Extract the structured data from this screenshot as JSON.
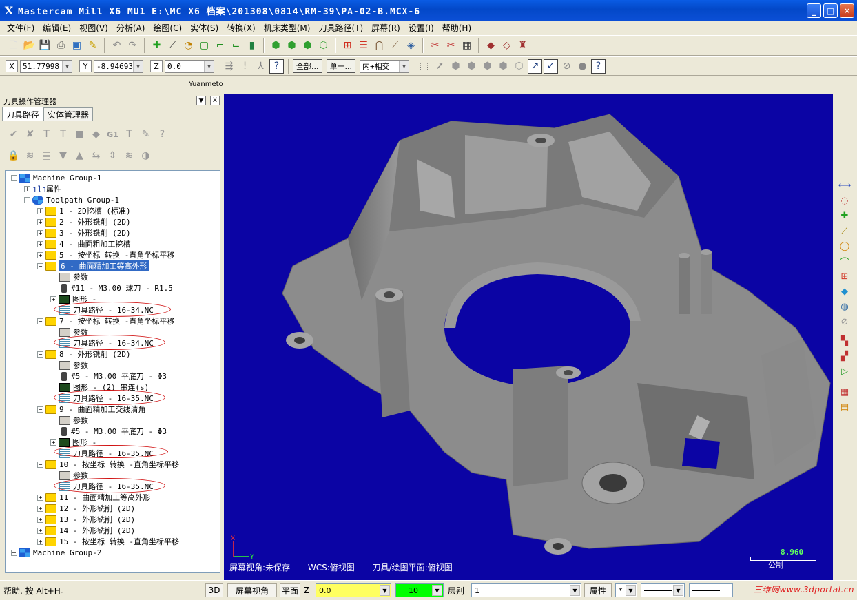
{
  "window": {
    "app_icon": "X",
    "title": "Mastercam Mill X6 MU1  E:\\MC X6 档案\\201308\\0814\\RM-39\\PA-02-B.MCX-6",
    "min_icon": "minimize-icon",
    "max_icon": "maximize-icon",
    "close_icon": "close-icon"
  },
  "menu": [
    "文件(F)",
    "编辑(E)",
    "视图(V)",
    "分析(A)",
    "绘图(C)",
    "实体(S)",
    "转换(X)",
    "机床类型(M)",
    "刀具路径(T)",
    "屏幕(R)",
    "设置(I)",
    "帮助(H)"
  ],
  "coords": {
    "x_label": "X",
    "x_value": "51.77998",
    "y_label": "Y",
    "y_value": "-8.94693",
    "z_label": "Z",
    "z_value": "0.0",
    "btn_all": "全部...",
    "btn_single": "单一...",
    "select_mode": "内+相交"
  },
  "status_user": "Yuanmeto",
  "panel": {
    "title": "刀具操作管理器",
    "tabs": [
      "刀具路径",
      "实体管理器"
    ],
    "g1_label": "G1"
  },
  "tree": {
    "machine_group_1": "Machine Group-1",
    "properties": "属性",
    "toolpath_group_1": "Toolpath Group-1",
    "op1": "1 - 2D挖槽 (标准)",
    "op2": "2 - 外形铣削 (2D)",
    "op3": "3 - 外形铣削 (2D)",
    "op4": "4 - 曲面粗加工挖槽",
    "op5": "5 - 按坐标 转换 -直角坐标平移",
    "op6": "6 - 曲面精加工等高外形",
    "op6_param": "参数",
    "op6_tool": "#11 - M3.00 球刀 - R1.5",
    "op6_geom": "图形 -",
    "op6_path": "刀具路径 - 16-34.NC",
    "op7": "7 - 按坐标 转换 -直角坐标平移",
    "op7_param": "参数",
    "op7_path": "刀具路径 - 16-34.NC",
    "op8": "8 - 外形铣削 (2D)",
    "op8_param": "参数",
    "op8_tool": "#5 - M3.00 平底刀 - Φ3",
    "op8_geom": "图形 - (2) 串连(s)",
    "op8_path": "刀具路径 - 16-35.NC",
    "op9": "9 - 曲面精加工交线清角",
    "op9_param": "参数",
    "op9_tool": "#5 - M3.00 平底刀 - Φ3",
    "op9_geom": "图形 -",
    "op9_path": "刀具路径 - 16-35.NC",
    "op10": "10 - 按坐标 转换 -直角坐标平移",
    "op10_param": "参数",
    "op10_path": "刀具路径 - 16-35.NC",
    "op11": "11 - 曲面精加工等高外形",
    "op12": "12 - 外形铣削 (2D)",
    "op13": "13 - 外形铣削 (2D)",
    "op14": "14 - 外形铣削 (2D)",
    "op15": "15 - 按坐标 转换 -直角坐标平移",
    "machine_group_2": "Machine Group-2"
  },
  "viewport": {
    "background": "#0b04a4",
    "part_color": "#8c8c8c",
    "screen_view": "屏幕视角:未保存",
    "wcs": "WCS:俯视图",
    "tool_plane": "刀具/绘图平面:俯视图",
    "scale_value": "8.960",
    "scale_unit": "公制",
    "axis_x": "X",
    "axis_y": "Y"
  },
  "bottombar": {
    "help": "帮助, 按 Alt+H。",
    "btn_3d": "3D",
    "btn_screen_view": "屏幕视角",
    "btn_plane": "平面",
    "z_label": "Z",
    "z_value": "0.0",
    "z_color": "#ffff60",
    "color_value": "10",
    "color_swatch": "#00ff00",
    "layer_label": "层别",
    "layer_value": "1",
    "attr_btn": "属性",
    "point_style": "*",
    "watermark": "三维网www.3dportal.cn"
  }
}
